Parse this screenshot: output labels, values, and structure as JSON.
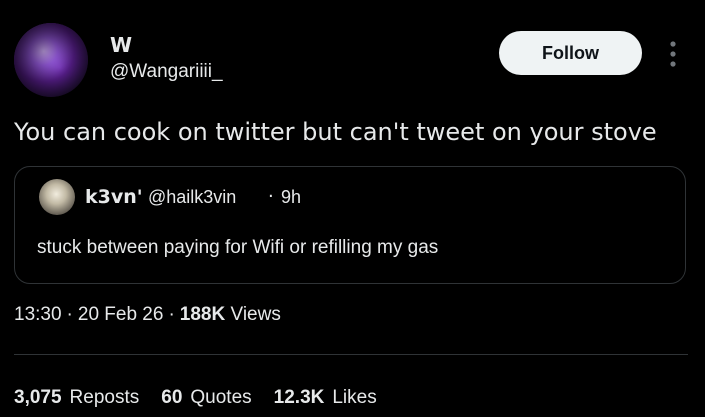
{
  "author": {
    "name": "W",
    "handle": "@Wangariiii_"
  },
  "follow_button": {
    "label": "Follow"
  },
  "more_icon": "more-vertical-icon",
  "tweet": {
    "text": "You can cook on twitter but can't tweet on your stove"
  },
  "quoted": {
    "name": "k3vn'",
    "handle": "@hailk3vin",
    "separator": "·",
    "time": "9h",
    "text": "stuck between paying for Wifi or refilling my gas"
  },
  "meta": {
    "time": "13:30",
    "date": "20 Feb 26",
    "views_count": "188K",
    "views_label": "Views",
    "separator": "·"
  },
  "stats": {
    "reposts_count": "3,075",
    "reposts_label": "Reposts",
    "quotes_count": "60",
    "quotes_label": "Quotes",
    "likes_count": "12.3K",
    "likes_label": "Likes"
  },
  "colors": {
    "background": "#000000",
    "text": "#e7e9ea",
    "border": "#2f3336",
    "button_bg": "#eff3f4",
    "button_text": "#0f1419"
  }
}
